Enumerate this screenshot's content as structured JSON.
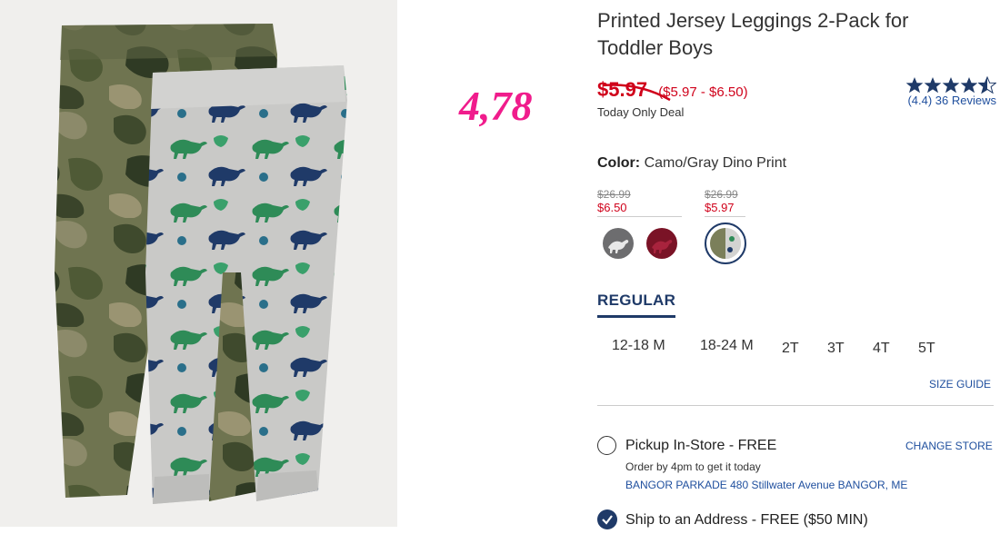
{
  "annotation": "4,78",
  "product": {
    "title_line1": "Printed Jersey Leggings 2-Pack for",
    "title_line2": "Toddler Boys",
    "sale_price": "$5.97",
    "price_range": "($5.97 - $6.50)",
    "deal_label": "Today Only Deal"
  },
  "rating": {
    "value": 4.4,
    "stars_max": 5,
    "reviews_text": "(4.4) 36 Reviews"
  },
  "color": {
    "label": "Color:",
    "selected": "Camo/Gray Dino Print",
    "groups": [
      {
        "was": "$26.99",
        "now": "$6.50"
      },
      {
        "was": "$26.99",
        "now": "$5.97"
      }
    ],
    "swatch_colors": [
      "#6d6d6f",
      "#7a1326",
      "#cfd3c6"
    ]
  },
  "size": {
    "tab": "REGULAR",
    "options": [
      "12-18 M",
      "18-24 M",
      "2T",
      "3T",
      "4T",
      "5T"
    ],
    "guide": "SIZE GUIDE"
  },
  "fulfillment": {
    "pickup_label": "Pickup In-Store - FREE",
    "change_store": "CHANGE STORE",
    "order_by": "Order by 4pm to get it today",
    "store": "BANGOR PARKADE 480 Stillwater Avenue  BANGOR, ME",
    "ship_label": "Ship to an Address - FREE ($50 MIN)"
  },
  "colors": {
    "sale_red": "#d0021b",
    "navy": "#1f3a68",
    "link_blue": "#1f4f9e",
    "annotation_pink": "#f01c8c"
  }
}
